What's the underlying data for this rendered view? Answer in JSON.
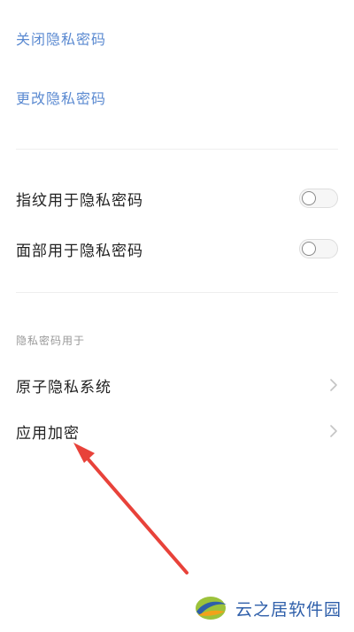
{
  "settings": {
    "close_password_label": "关闭隐私密码",
    "change_password_label": "更改隐私密码",
    "fingerprint_label": "指纹用于隐私密码",
    "fingerprint_enabled": false,
    "face_label": "面部用于隐私密码",
    "face_enabled": false,
    "section_header": "隐私密码用于",
    "items": [
      {
        "label": "原子隐私系统"
      },
      {
        "label": "应用加密"
      }
    ]
  },
  "annotation": {
    "arrow_color": "#e8423a"
  },
  "watermark": {
    "text": "云之居软件园"
  },
  "colors": {
    "link": "#5b8ad1",
    "item_text": "#222222",
    "section_label": "#999999"
  }
}
